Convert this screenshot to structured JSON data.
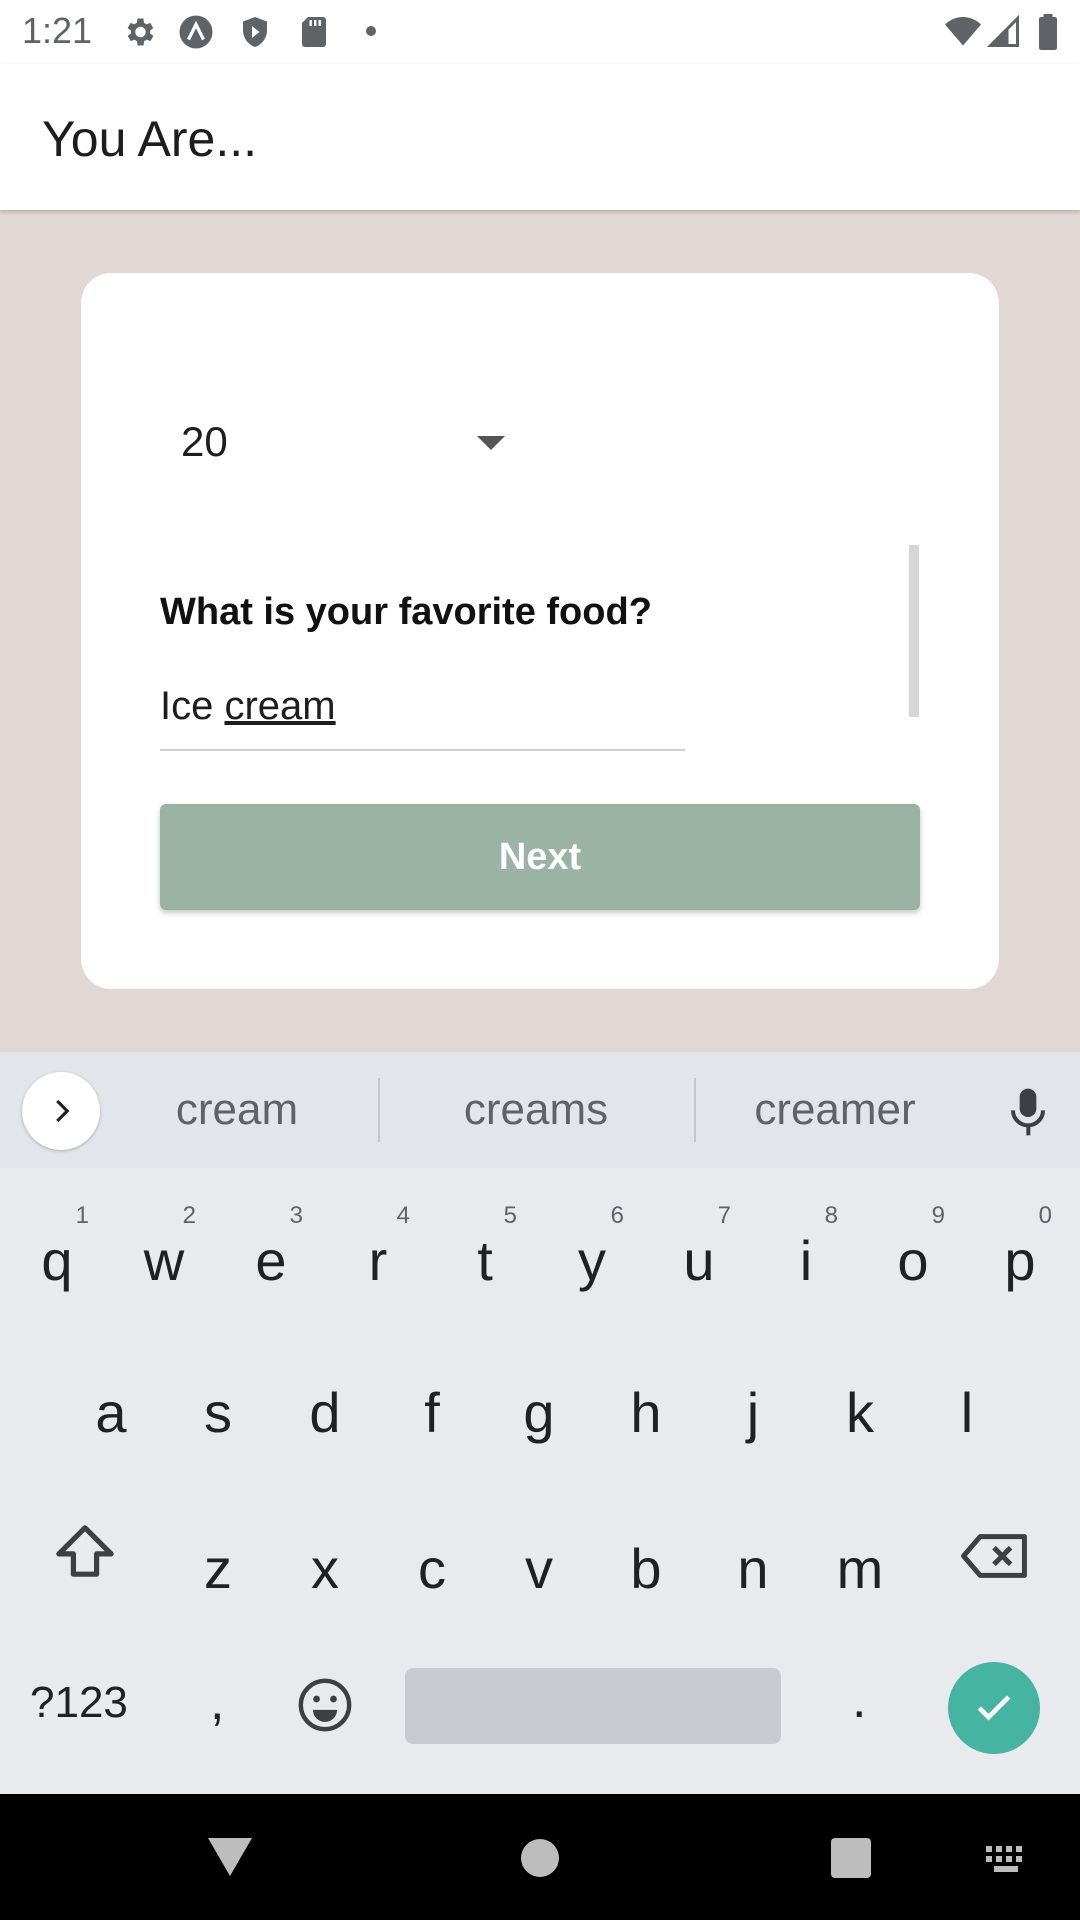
{
  "status_bar": {
    "time": "1:21",
    "icons": [
      "gear-icon",
      "app-a-icon",
      "shield-play-icon",
      "sd-card-icon",
      "dot-icon",
      "wifi-icon",
      "signal-icon",
      "battery-icon"
    ]
  },
  "app_bar": {
    "title": "You Are..."
  },
  "form": {
    "age_value": "20",
    "question": "What is your favorite food?",
    "answer_plain": "Ice ",
    "answer_underlined": "cream",
    "next_label": "Next"
  },
  "keyboard": {
    "suggestions": [
      "cream",
      "creams",
      "creamer"
    ],
    "row1": [
      {
        "letter": "q",
        "num": "1"
      },
      {
        "letter": "w",
        "num": "2"
      },
      {
        "letter": "e",
        "num": "3"
      },
      {
        "letter": "r",
        "num": "4"
      },
      {
        "letter": "t",
        "num": "5"
      },
      {
        "letter": "y",
        "num": "6"
      },
      {
        "letter": "u",
        "num": "7"
      },
      {
        "letter": "i",
        "num": "8"
      },
      {
        "letter": "o",
        "num": "9"
      },
      {
        "letter": "p",
        "num": "0"
      }
    ],
    "row2": [
      "a",
      "s",
      "d",
      "f",
      "g",
      "h",
      "j",
      "k",
      "l"
    ],
    "row3": [
      "z",
      "x",
      "c",
      "v",
      "b",
      "n",
      "m"
    ],
    "symbols_label": "?123",
    "comma_label": ",",
    "period_label": "."
  },
  "colors": {
    "background": "#e1d7d4",
    "next_button": "#9ab3a4",
    "enter_key": "#46b4a3"
  }
}
